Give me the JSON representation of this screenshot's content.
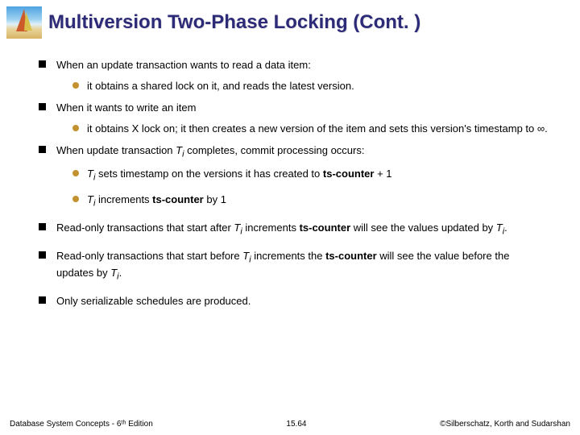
{
  "title": "Multiversion Two-Phase Locking (Cont. )",
  "bullets": {
    "b1": "When an update transaction wants to read a data item:",
    "b1a": "it obtains a shared lock on it, and reads the latest version.",
    "b2": "When it wants to write an item",
    "b2a_pre": "it obtains X lock on; it then creates a new version of the item and sets this version's timestamp to ",
    "b2a_sym": "∞",
    "b2a_post": ".",
    "b3_pre": "When update transaction ",
    "b3_post": " completes, commit processing occurs:",
    "b3a_post": " sets timestamp on the versions it has created to  ",
    "b3a_bold": "ts-counter",
    "b3a_end": " + 1",
    "b3b_post": " increments  ",
    "b3b_bold": "ts-counter",
    "b3b_end": " by 1",
    "b4_pre": "Read-only transactions that start after ",
    "b4_mid": " increments ",
    "b4_bold": "ts-counter",
    "b4_post": " will see the values updated by ",
    "b4_end": ".",
    "b5_pre": "Read-only transactions that start before ",
    "b5_mid": " increments the ",
    "b5_bold": "ts-counter",
    "b5_post": " will see the value before the updates by ",
    "b5_end": ".",
    "b6": "Only serializable schedules are produced.",
    "Ti": "T",
    "i": "i"
  },
  "footer": {
    "left": "Database System Concepts - 6ᵗʰ Edition",
    "center": "15.64",
    "right": "©Silberschatz, Korth and Sudarshan"
  }
}
